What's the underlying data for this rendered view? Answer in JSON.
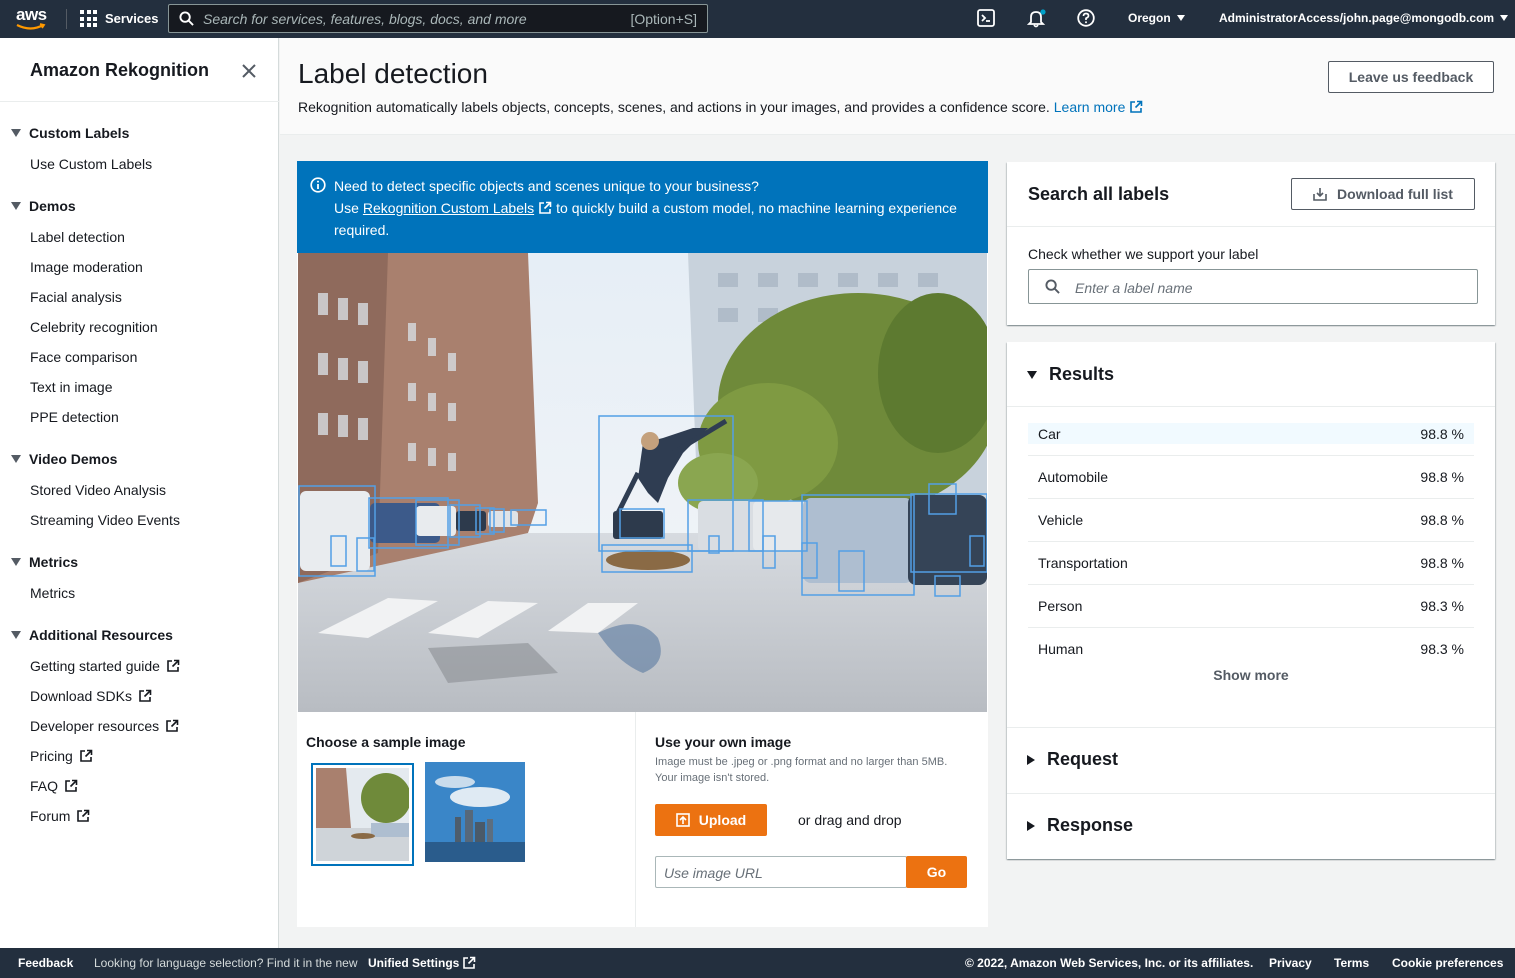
{
  "topnav": {
    "logo_text": "aws",
    "services_label": "Services",
    "search_placeholder": "Search for services, features, blogs, docs, and more",
    "search_shortcut": "[Option+S]",
    "region": "Oregon",
    "account": "AdministratorAccess/john.page@mongodb.com",
    "notification_dot_color": "#00a1c9"
  },
  "sidebar": {
    "title": "Amazon Rekognition",
    "sections": [
      {
        "label": "Custom Labels",
        "items": [
          "Use Custom Labels"
        ]
      },
      {
        "label": "Demos",
        "items": [
          "Label detection",
          "Image moderation",
          "Facial analysis",
          "Celebrity recognition",
          "Face comparison",
          "Text in image",
          "PPE detection"
        ]
      },
      {
        "label": "Video Demos",
        "items": [
          "Stored Video Analysis",
          "Streaming Video Events"
        ]
      },
      {
        "label": "Metrics",
        "items": [
          "Metrics"
        ]
      },
      {
        "label": "Additional Resources",
        "items": [
          "Getting started guide",
          "Download SDKs",
          "Developer resources",
          "Pricing",
          "FAQ",
          "Forum"
        ]
      }
    ]
  },
  "header": {
    "title": "Label detection",
    "description": "Rekognition automatically labels objects, concepts, scenes, and actions in your images, and provides a confidence score.",
    "learn_more": "Learn more",
    "feedback_button": "Leave us feedback"
  },
  "info": {
    "line1": "Need to detect specific objects and scenes unique to your business?",
    "line2_prefix": "Use",
    "line2_link": "Rekognition Custom Labels",
    "line2_suffix": "to quickly build a custom model, no machine learning experience",
    "line3": "required."
  },
  "sample": {
    "title": "Choose a sample image"
  },
  "own_image": {
    "title": "Use your own image",
    "description": "Image must be .jpeg or .png format and no larger than 5MB. Your image isn't stored.",
    "upload_label": "Upload",
    "drag_drop": "or drag and drop",
    "url_placeholder": "Use image URL",
    "go_label": "Go"
  },
  "search_labels": {
    "title": "Search all labels",
    "download_label": "Download full list",
    "check_label": "Check whether we support your label",
    "input_placeholder": "Enter a label name"
  },
  "results": {
    "title": "Results",
    "rows": [
      {
        "label": "Car",
        "confidence": "98.8 %"
      },
      {
        "label": "Automobile",
        "confidence": "98.8 %"
      },
      {
        "label": "Vehicle",
        "confidence": "98.8 %"
      },
      {
        "label": "Transportation",
        "confidence": "98.8 %"
      },
      {
        "label": "Person",
        "confidence": "98.3 %"
      },
      {
        "label": "Human",
        "confidence": "98.3 %"
      }
    ],
    "show_more": "Show more",
    "request_label": "Request",
    "response_label": "Response"
  },
  "footer": {
    "feedback": "Feedback",
    "language_prompt": "Looking for language selection? Find it in the new",
    "unified_settings": "Unified Settings",
    "copyright": "© 2022, Amazon Web Services, Inc. or its affiliates.",
    "privacy": "Privacy",
    "terms": "Terms",
    "cookie": "Cookie preferences"
  },
  "colors": {
    "nav_bg": "#232f3e",
    "accent_orange": "#ec7211",
    "link_blue": "#0073bb",
    "info_blue": "#0073bb",
    "highlight_row": "#f1faff"
  }
}
